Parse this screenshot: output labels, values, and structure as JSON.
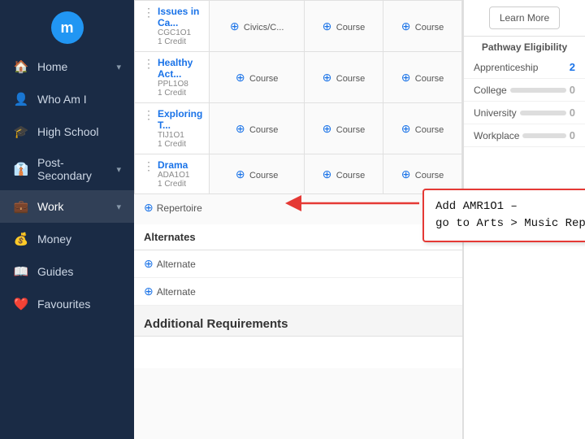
{
  "sidebar": {
    "logo": "m",
    "items": [
      {
        "id": "home",
        "icon": "🏠",
        "label": "Home",
        "hasChevron": true
      },
      {
        "id": "who-am-i",
        "icon": "👤",
        "label": "Who Am I",
        "hasChevron": false
      },
      {
        "id": "high-school",
        "icon": "🎓",
        "label": "High School",
        "hasChevron": false
      },
      {
        "id": "post-secondary",
        "icon": "👔",
        "label": "Post-Secondary",
        "hasChevron": true
      },
      {
        "id": "work",
        "icon": "💼",
        "label": "Work",
        "hasChevron": true,
        "active": true
      },
      {
        "id": "money",
        "icon": "💰",
        "label": "Money",
        "hasChevron": false
      },
      {
        "id": "guides",
        "icon": "📖",
        "label": "Guides",
        "hasChevron": false
      },
      {
        "id": "favourites",
        "icon": "❤️",
        "label": "Favourites",
        "hasChevron": false
      }
    ]
  },
  "courses": [
    {
      "name": "Issues in Ca...",
      "code": "CGC1O1",
      "credit": "1 Credit",
      "cols": [
        "Civics/C...",
        "Course",
        "Course"
      ]
    },
    {
      "name": "Healthy Act...",
      "code": "PPL1O8",
      "credit": "1 Credit",
      "cols": [
        "Course",
        "Course",
        "Course"
      ]
    },
    {
      "name": "Exploring T...",
      "code": "TIJ1O1",
      "credit": "1 Credit",
      "cols": [
        "Course",
        "Course",
        "Course"
      ]
    },
    {
      "name": "Drama",
      "code": "ADA1O1",
      "credit": "1 Credit",
      "cols": [
        "Course",
        "Course",
        "Course"
      ]
    }
  ],
  "repertoire": {
    "label": "Repertoire"
  },
  "alternates": {
    "header": "Alternates",
    "items": [
      "Alternate",
      "Alternate"
    ]
  },
  "additional_requirements": {
    "label": "Additional Requirements"
  },
  "right_panel": {
    "learn_more": "Learn More",
    "pathway_eligibility": "Pathway Eligibility",
    "items": [
      {
        "name": "Apprenticeship",
        "count": "2",
        "isBlue": true
      },
      {
        "name": "College",
        "count": "0",
        "isBlue": false
      },
      {
        "name": "University",
        "count": "0",
        "isBlue": false
      },
      {
        "name": "Workplace",
        "count": "0",
        "isBlue": false
      }
    ]
  },
  "annotation": {
    "line1": "Add AMR1O1 –",
    "line2": "go to Arts > Music Repertoire"
  }
}
